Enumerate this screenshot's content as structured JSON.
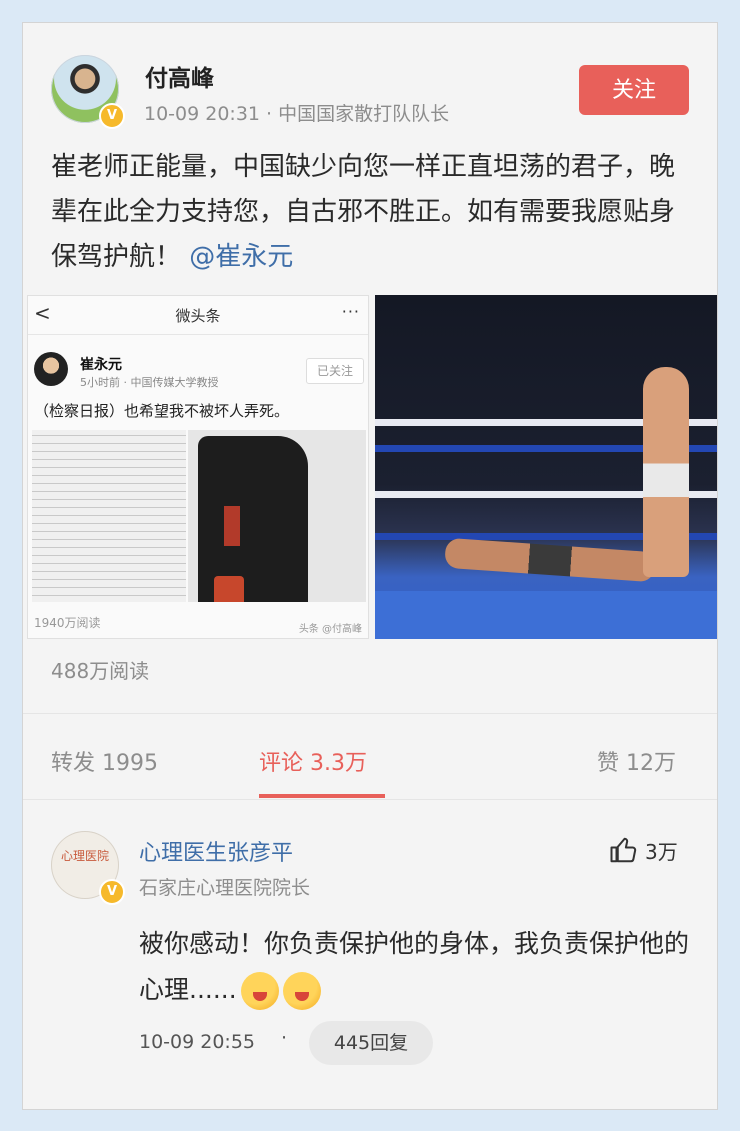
{
  "post": {
    "author": "付高峰",
    "meta": "10-09 20:31 · 中国国家散打队队长",
    "follow_label": "关注",
    "text": "崔老师正能量，中国缺少向您一样正直坦荡的君子，晚辈在此全力支持您，自古邪不胜正。如有需要我愿贴身保驾护航！",
    "mention": "@崔永元",
    "verified_mark": "V"
  },
  "embedded_screenshot": {
    "back": "<",
    "title": "微头条",
    "more": "···",
    "author": "崔永元",
    "meta": "5小时前 · 中国传媒大学教授",
    "follow_state": "已关注",
    "text": "（检察日报）也希望我不被坏人弄死。",
    "reads": "1940万阅读",
    "watermark": "头条 @付高峰"
  },
  "stats": {
    "reads": "488万阅读",
    "repost": "转发 1995",
    "comment": "评论 3.3万",
    "like": "赞 12万"
  },
  "comment": {
    "author": "心理医生张彦平",
    "meta": "石家庄心理医院院长",
    "likes": "3万",
    "text": "被你感动！你负责保护他的身体，我负责保护他的心理......",
    "time": "10-09 20:55",
    "dot": "·",
    "replies": "445回复",
    "avatar_text": "心理医院",
    "verified_mark": "V"
  },
  "colors": {
    "accent": "#e8605a",
    "link": "#3f6ea8",
    "background": "#dbe9f6"
  },
  "icons": [
    "thumbs-up-icon",
    "verified-badge-icon",
    "back-arrow-icon",
    "more-icon",
    "grin-emoji-icon"
  ]
}
